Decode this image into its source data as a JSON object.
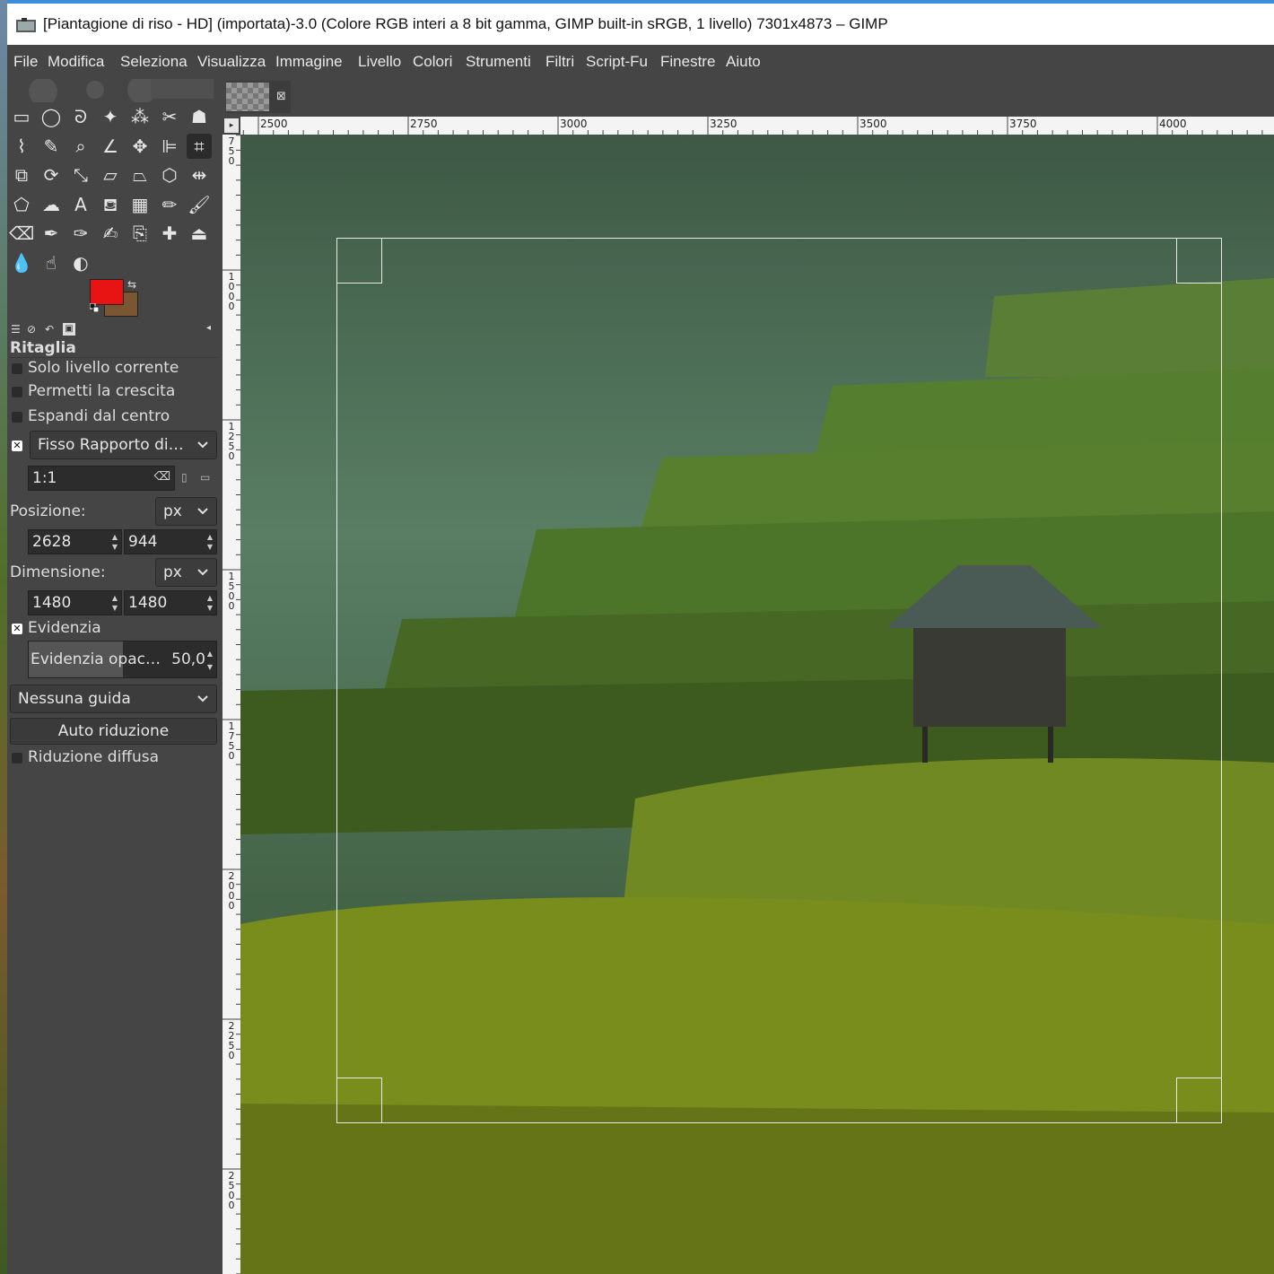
{
  "window": {
    "title": "[Piantagione di riso - HD] (importata)-3.0 (Colore RGB interi a 8 bit gamma, GIMP built-in sRGB, 1 livello) 7301x4873 – GIMP"
  },
  "menu": [
    "File",
    "Modifica",
    "Seleziona",
    "Visualizza",
    "Immagine",
    "Livello",
    "Colori",
    "Strumenti",
    "Filtri",
    "Script-Fu",
    "Finestre",
    "Aiuto"
  ],
  "colors": {
    "foreground": "#e81414",
    "background": "#7a5632",
    "accent": "#3a8fd8"
  },
  "tools": [
    "rect-select-icon",
    "ellipse-select-icon",
    "free-select-icon",
    "fuzzy-select-icon",
    "by-color-select-icon",
    "scissors-icon",
    "foreground-select-icon",
    "paths-icon",
    "color-picker-icon",
    "zoom-icon",
    "measure-icon",
    "move-icon",
    "align-icon",
    "crop-icon",
    "unified-transform-icon",
    "rotate-icon",
    "scale-icon",
    "shear-icon",
    "perspective-icon",
    "3d-transform-icon",
    "flip-icon",
    "cage-icon",
    "warp-icon",
    "text-icon",
    "bucket-fill-icon",
    "gradient-icon",
    "pencil-icon",
    "paintbrush-icon",
    "eraser-icon",
    "airbrush-icon",
    "ink-icon",
    "mypaint-brush-icon",
    "clone-icon",
    "heal-icon",
    "perspective-clone-icon",
    "blur-icon",
    "smudge-icon",
    "dodge-burn-icon"
  ],
  "tool_options": {
    "title": "Ritaglia",
    "current_layer_only": {
      "label": "Solo livello corrente",
      "checked": false
    },
    "allow_growing": {
      "label": "Permetti la crescita",
      "checked": false
    },
    "expand_from_center": {
      "label": "Espandi dal centro",
      "checked": false
    },
    "fixed": {
      "checked": true,
      "mode": "Fisso Rapporto di…",
      "ratio": "1:1"
    },
    "position": {
      "label": "Posizione:",
      "unit": "px",
      "x": "2628",
      "y": "944"
    },
    "size": {
      "label": "Dimensione:",
      "unit": "px",
      "w": "1480",
      "h": "1480"
    },
    "highlight": {
      "label": "Evidenzia",
      "checked": true,
      "opacity_label": "Evidenzia opac…",
      "opacity_value": "50,0"
    },
    "guides": "Nessuna guida",
    "auto_shrink": "Auto riduzione",
    "shrink_merged": {
      "label": "Riduzione diffusa",
      "checked": false
    }
  },
  "rulers": {
    "horizontal": [
      "2500",
      "2750",
      "3000",
      "3250",
      "3500",
      "3750",
      "4000"
    ],
    "vertical": [
      "750",
      "1000",
      "1250",
      "1500",
      "1750",
      "2000",
      "2250",
      "2500"
    ]
  }
}
